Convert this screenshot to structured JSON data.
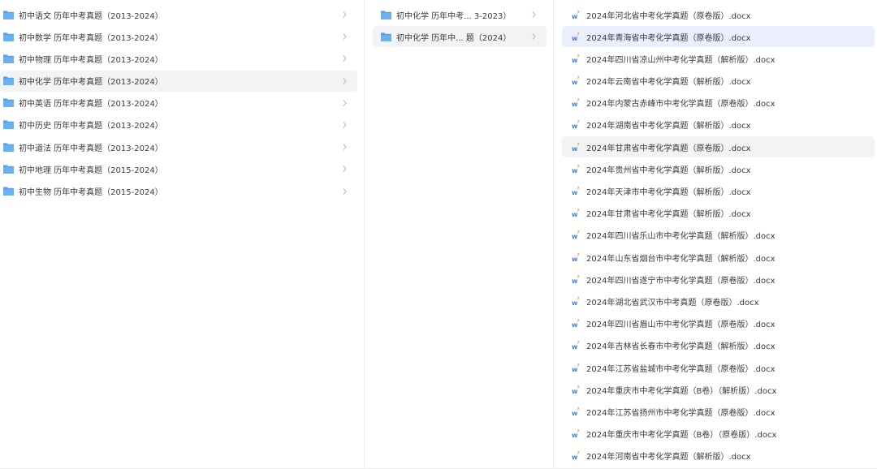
{
  "columns": {
    "subjects": {
      "items": [
        {
          "label": "初中语文 历年中考真题（2013-2024）"
        },
        {
          "label": "初中数学 历年中考真题（2013-2024）"
        },
        {
          "label": "初中物理 历年中考真题（2013-2024）"
        },
        {
          "label": "初中化学 历年中考真题（2013-2024）"
        },
        {
          "label": "初中英语 历年中考真题（2013-2024）"
        },
        {
          "label": "初中历史 历年中考真题（2013-2024）"
        },
        {
          "label": "初中道法 历年中考真题（2013-2024）"
        },
        {
          "label": "初中地理 历年中考真题（2015-2024）"
        },
        {
          "label": "初中生物 历年中考真题（2015-2024）"
        }
      ],
      "active_index": 3
    },
    "years": {
      "items": [
        {
          "label": "初中化学 历年中考... 3-2023）"
        },
        {
          "label": "初中化学 历年中... 题（2024）"
        }
      ],
      "selected_index": 1
    },
    "files": {
      "items": [
        {
          "label": "2024年河北省中考化学真题（原卷版）.docx"
        },
        {
          "label": "2024年青海省中考化学真题（原卷版）.docx"
        },
        {
          "label": "2024年四川省凉山州中考化学真题（解析版）.docx"
        },
        {
          "label": "2024年云南省中考化学真题（解析版）.docx"
        },
        {
          "label": "2024年内蒙古赤峰市中考化学真题（原卷版）.docx"
        },
        {
          "label": "2024年湖南省中考化学真题（解析版）.docx"
        },
        {
          "label": "2024年甘肃省中考化学真题（原卷版）.docx"
        },
        {
          "label": "2024年贵州省中考化学真题（解析版）.docx"
        },
        {
          "label": "2024年天津市中考化学真题（解析版）.docx"
        },
        {
          "label": "2024年甘肃省中考化学真题（解析版）.docx"
        },
        {
          "label": "2024年四川省乐山市中考化学真题（解析版）.docx"
        },
        {
          "label": "2024年山东省烟台市中考化学真题（解析版）.docx"
        },
        {
          "label": "2024年四川省遂宁市中考化学真题（原卷版）.docx"
        },
        {
          "label": "2024年湖北省武汉市中考真题（原卷版）.docx"
        },
        {
          "label": "2024年四川省眉山市中考化学真题（原卷版）.docx"
        },
        {
          "label": "2024年吉林省长春市中考化学真题（解析版）.docx"
        },
        {
          "label": "2024年江苏省盐城市中考化学真题（原卷版）.docx"
        },
        {
          "label": "2024年重庆市中考化学真题（B卷）（解析版）.docx"
        },
        {
          "label": "2024年江苏省扬州市中考化学真题（原卷版）.docx"
        },
        {
          "label": "2024年重庆市中考化学真题（B卷）（原卷版）.docx"
        },
        {
          "label": "2024年河南省中考化学真题（解析版）.docx"
        }
      ],
      "selected_index": 1,
      "hover_index": 6
    }
  },
  "icons": {
    "folder": "folder-icon",
    "word_document": "word-doc-icon",
    "chevron": "chevron-right-icon"
  },
  "colors": {
    "folder": "#5aa0e6",
    "word": "#3f7ee8",
    "selected_row": "#ebeefc",
    "hover_row": "#f2f3f5"
  }
}
